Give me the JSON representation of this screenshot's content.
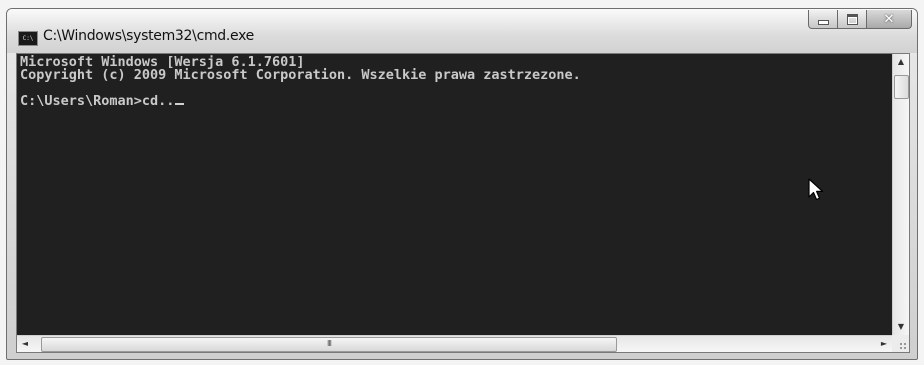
{
  "window": {
    "title": "C:\\Windows\\system32\\cmd.exe",
    "icon": "cmd-icon",
    "icon_text": "C:\\"
  },
  "caption_buttons": {
    "minimize_icon": "minimize-icon",
    "maximize_icon": "maximize-icon",
    "close_icon": "close-icon",
    "close_glyph": "✕"
  },
  "console": {
    "lines": [
      "Microsoft Windows [Wersja 6.1.7601]",
      "Copyright (c) 2009 Microsoft Corporation. Wszelkie prawa zastrzezone.",
      "",
      "C:\\Users\\Roman>cd.."
    ],
    "colors": {
      "background": "#202020",
      "text": "#c9c9c9"
    }
  },
  "scrollbars": {
    "up_arrow": "▲",
    "down_arrow": "▼",
    "left_arrow": "◄",
    "right_arrow": "►",
    "h_thumb_grip": "III"
  }
}
